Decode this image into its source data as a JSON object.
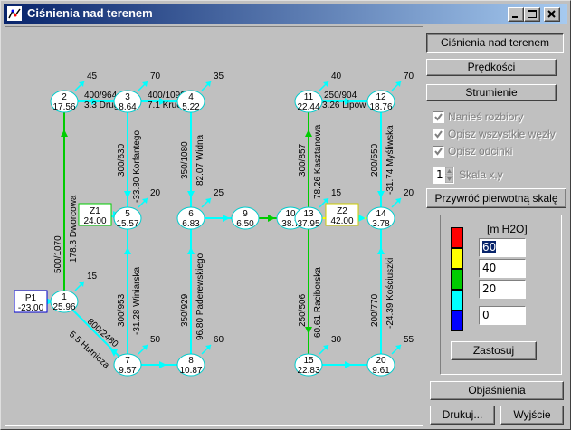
{
  "window": {
    "title": "Ciśnienia nad terenem"
  },
  "toolbar": {
    "btn_pressure": "Ciśnienia nad terenem",
    "btn_velocity": "Prędkości",
    "btn_flow": "Strumienie",
    "chk_demand": "Nanieś rozbiory",
    "chk_nodes": "Opisz wszystkie węzły",
    "chk_segments": "Opisz odcinki",
    "scale_label": "Skala x,y",
    "scale_value": "1",
    "btn_restore": "Przywróć pierwotną skalę"
  },
  "legend": {
    "unit": "[m H2O]",
    "values": [
      "60",
      "40",
      "20",
      "0"
    ],
    "colors": [
      "#ff0000",
      "#ffff00",
      "#00cc00",
      "#00ffff",
      "#0000ff"
    ],
    "btn_apply": "Zastosuj"
  },
  "footer": {
    "btn_explain": "Objaśnienia",
    "btn_print": "Drukuj...",
    "btn_exit": "Wyjście"
  },
  "network": {
    "nodes": [
      {
        "id": "2",
        "value": "17.56",
        "demand": "45"
      },
      {
        "id": "3",
        "value": "8.64",
        "demand": "70"
      },
      {
        "id": "4",
        "value": "5.22",
        "demand": "35"
      },
      {
        "id": "11",
        "value": "22.44",
        "demand": "40"
      },
      {
        "id": "12",
        "value": "18.76",
        "demand": "70"
      },
      {
        "id": "5",
        "value": "15.57",
        "demand": "20"
      },
      {
        "id": "6",
        "value": "6.83",
        "demand": "25"
      },
      {
        "id": "9",
        "value": "6.50"
      },
      {
        "id": "10",
        "value": "38.7"
      },
      {
        "id": "13",
        "value": "37.95",
        "demand": "15"
      },
      {
        "id": "14",
        "value": "3.78",
        "demand": "20"
      },
      {
        "id": "1",
        "value": "25.96",
        "demand": "15"
      },
      {
        "id": "7",
        "value": "9.57",
        "demand": "50"
      },
      {
        "id": "8",
        "value": "10.87",
        "demand": "60"
      },
      {
        "id": "15",
        "value": "22.83",
        "demand": "30"
      },
      {
        "id": "20",
        "value": "9.61",
        "demand": "55"
      }
    ],
    "sources": [
      {
        "id": "P1",
        "value": "-23.00"
      },
      {
        "id": "Z1",
        "value": "24.00"
      },
      {
        "id": "Z2",
        "value": "42.00"
      }
    ],
    "pipe_labels": {
      "p2_3": "400/964",
      "p2_3_name": "3.3 Drug",
      "p3_4": "400/1090",
      "p3_4_name": "7.1 Krucz",
      "p11_12": "250/904",
      "p11_12_name": "3.26 Lipow",
      "p3_5": "300/630",
      "p3_5_name": "-33.80 Korfantego",
      "p4_6": "350/1080",
      "p4_6_name": "82.07 Widna",
      "p11_13": "300/857",
      "p11_13_name": "78.26 Kasztanowa",
      "p12_14": "200/550",
      "p12_14_name": "-31.74 Myśliwska",
      "p1_2": "500/1070",
      "p1_2_name": "178.3 Dworcowa",
      "p5_7": "300/953",
      "p5_7_name": "-31.28 Winiarska",
      "p6_8": "350/929",
      "p6_8_name": "96.80 Paderewskiego",
      "p13_15": "250/506",
      "p13_15_name": "60.61 Raciborska",
      "p14_20": "200/770",
      "p14_20_name": "-24.39 Kościuszki",
      "p1_7": "800/2480",
      "p1_7_name": "5.5 Hutnicza"
    }
  }
}
